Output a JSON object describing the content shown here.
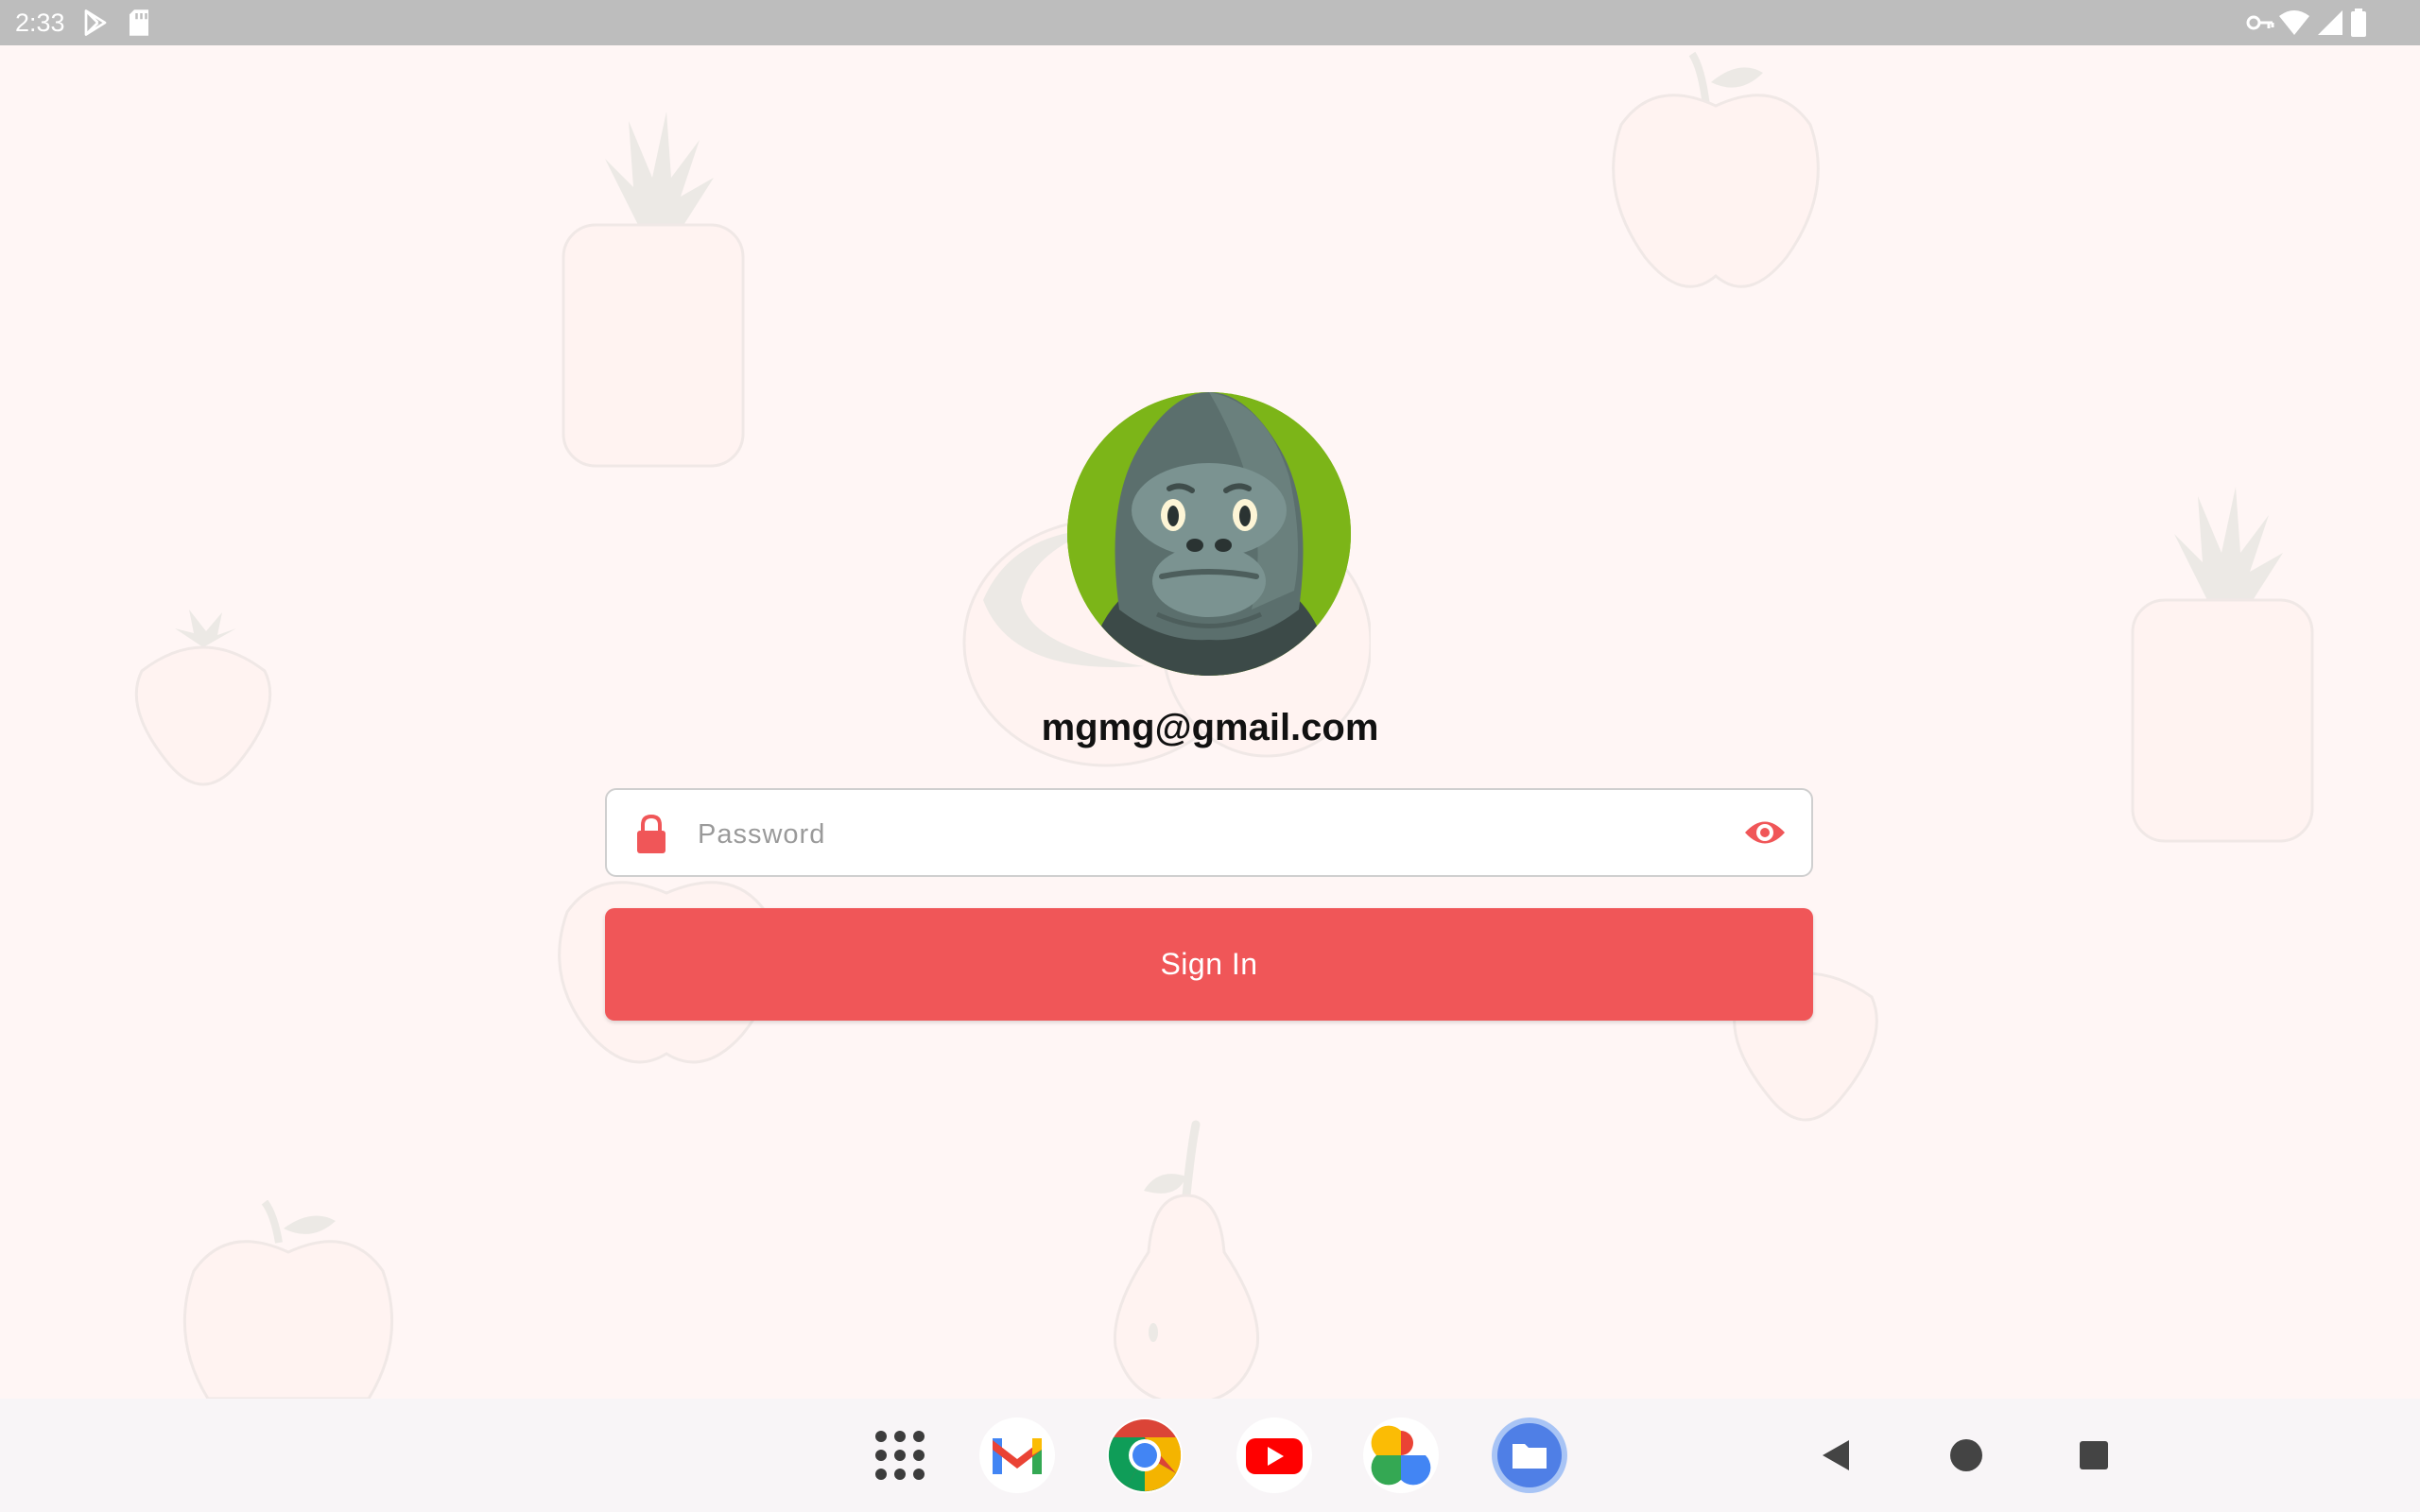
{
  "status_bar": {
    "time": "2:33",
    "left_icons": [
      "play-store-icon",
      "sd-card-icon"
    ],
    "right_icons": [
      "vpn-key-icon",
      "wifi-icon",
      "cell-signal-icon",
      "battery-icon"
    ]
  },
  "profile": {
    "avatar": "gorilla-avatar",
    "email": "mgmg@gmail.com"
  },
  "password": {
    "placeholder": "Password",
    "value": "",
    "lock_icon": "lock-icon",
    "visibility_icon": "eye-icon"
  },
  "sign_in": {
    "label": "Sign In"
  },
  "dock": {
    "apps": [
      "app-drawer",
      "gmail",
      "chrome",
      "youtube",
      "photos",
      "files"
    ]
  },
  "nav": [
    "back",
    "home",
    "recents"
  ],
  "colors": {
    "accent": "#f05658",
    "background": "#fff6f5",
    "status_bar": "#bdbdbd"
  }
}
